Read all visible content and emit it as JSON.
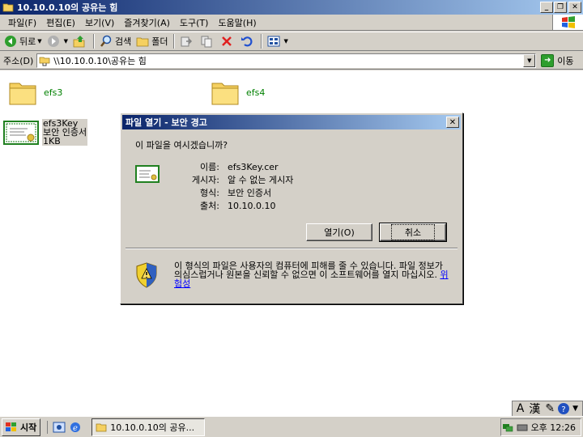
{
  "window": {
    "title": "10.10.0.10의 공유는 힘",
    "buttons": {
      "minimize": "_",
      "restore": "❐",
      "close": "✕"
    }
  },
  "menu": [
    "파일(F)",
    "편집(E)",
    "보기(V)",
    "즐겨찾기(A)",
    "도구(T)",
    "도움말(H)"
  ],
  "toolbar": {
    "back": "뒤로",
    "search": "검색",
    "folders": "폴더"
  },
  "address": {
    "label": "주소(D)",
    "value": "\\\\10.10.0.10\\공유는 힘",
    "go": "이동"
  },
  "files": [
    {
      "name": "efs3"
    },
    {
      "name": "efs4"
    }
  ],
  "cert_file": {
    "name": "efs3Key",
    "type": "보안 인증서",
    "size": "1KB"
  },
  "dialog": {
    "title": "파일 열기 - 보안 경고",
    "question": "이 파일을 여시겠습니까?",
    "props": [
      {
        "key": "이름:",
        "value": "efs3Key.cer"
      },
      {
        "key": "게시자:",
        "value": "알 수 없는 게시자"
      },
      {
        "key": "형식:",
        "value": "보안 인증서"
      },
      {
        "key": "출처:",
        "value": "10.10.0.10"
      }
    ],
    "open_button": "열기(O)",
    "cancel_button": "취소",
    "warning": "이 형식의 파일은 사용자의 컴퓨터에 피해를 줄 수 있습니다. 파일 정보가 의심스럽거나 원본을 신뢰할 수 없으면 이 소프트웨어를 열지 마십시오.",
    "warning_link": "위험성"
  },
  "ime": {
    "a": "A",
    "han": "漢"
  },
  "taskbar": {
    "start": "시작",
    "task": "10.10.0.10의 공유...",
    "clock": "오후 12:26"
  }
}
